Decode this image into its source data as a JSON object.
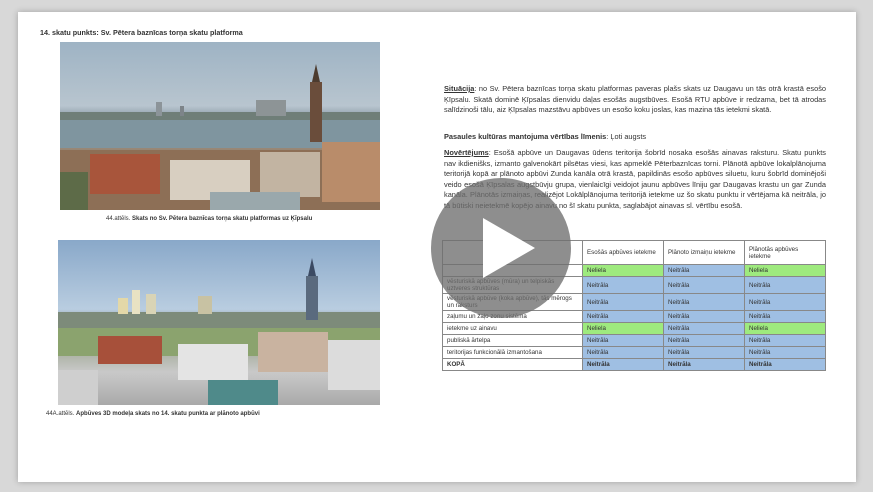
{
  "heading": "14. skatu punkts: Sv. Pētera baznīcas torņa skatu platforma",
  "figures": [
    {
      "caption_num": "44.attēls.",
      "caption_text": "Skats no Sv. Pētera baznīcas torņa skatu platformas uz Ķīpsalu"
    },
    {
      "caption_num": "44A.attēls.",
      "caption_text": "Apbūves 3D modeļa skats no 14. skatu punkta ar plānoto apbūvi"
    }
  ],
  "paragraphs": {
    "situacija_label": "Situācija",
    "situacija_text": ": no Sv. Pētera baznīcas torņa skatu platformas paveras plašs skats uz Daugavu un tās otrā krastā esošo Ķīpsalu. Skatā dominē Ķīpsalas dienvidu daļas esošās augstbūves. Esošā RTU apbūve ir redzama, bet tā atrodas salīdzinoši tālu, aiz Ķīpsalas mazstāvu apbūves un esošo koku joslas, kas mazina tās ietekmi skatā.",
    "vertibas_label": "Pasaules kultūras mantojuma vērtības līmenis",
    "vertibas_text": ": Ļoti augsts",
    "novertejums_label": "Novērtējums",
    "novertejums_text": ": Esošā apbūve un Daugavas ūdens teritorija šobrīd nosaka esošās ainavas raksturu. Skatu punkts nav ikdienišks, izmanto galvenokārt pilsētas viesi, kas apmeklē Pēterbaznīcas torni. Plānotā apbūve lokalplānojuma teritorijā kopā ar plānoto apbūvi Zunda kanāla otrā krastā, papildinās esošo apbūves siluetu, kuru šobrīd dominējoši veido esošā Ķīpsalas augstbūvju grupa, vienlaicīgi veidojot jaunu apbūves līniju gar Daugavas krastu un gar Zunda kanāla. Plānotās izmaiņas, realizējot Lokālplānojuma teritorijā ietekme uz šo skatu punktu ir vērtējama kā neitrāla, jo tā būtiski neietekmē kopējo ainavu no šī skatu punkta, saglabājot ainavas sl. vērtību esošā."
  },
  "table": {
    "headers": [
      "",
      "Esošās apbūves ietekme",
      "Plānoto izmaiņu ietekme",
      "Plānotās apbūves ietekme"
    ],
    "rows": [
      [
        "",
        "Neliela",
        "Neitrāla",
        "Neliela"
      ],
      [
        "vēsturiskā apbūves (mūra) un telpiskās uztveres struktūras",
        "Neitrāla",
        "Neitrāla",
        "Neitrāla"
      ],
      [
        "vēsturiskā apbūve (koka apbūve), tās mērogs un raksturs",
        "Neitrāla",
        "Neitrāla",
        "Neitrāla"
      ],
      [
        "zaļumu un zaļo zonu sistēma",
        "Neitrāla",
        "Neitrāla",
        "Neitrāla"
      ],
      [
        "ietekme uz ainavu",
        "Neliela",
        "Neitrāla",
        "Neliela"
      ],
      [
        "publiskā ārtelpa",
        "Neitrāla",
        "Neitrāla",
        "Neitrāla"
      ],
      [
        "teritorijas funkcionālā izmantošana",
        "Neitrāla",
        "Neitrāla",
        "Neitrāla"
      ],
      [
        "KOPĀ",
        "Neitrāla",
        "Neitrāla",
        "Neitrāla"
      ]
    ]
  },
  "colors": {
    "neliela": "#9eea7e",
    "neitrala": "#9fbfe3"
  },
  "overlay": {
    "icon": "play-icon"
  }
}
